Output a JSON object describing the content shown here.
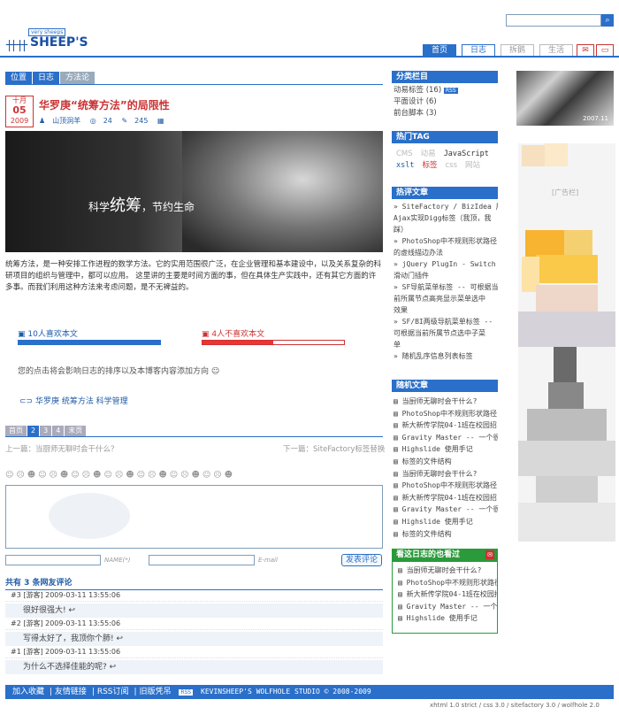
{
  "header": {
    "logo_tag": "very sheeps",
    "logo_text": "SHEEP'S",
    "search_icon": "search-icon",
    "nav": [
      {
        "label": "首页",
        "active": true
      },
      {
        "label": "日志",
        "active": false
      },
      {
        "label": "拆鹅",
        "active": false
      },
      {
        "label": "生活",
        "active": false
      }
    ]
  },
  "breadcrumb": [
    "位置",
    "日志",
    "方法论"
  ],
  "post": {
    "month": "十月",
    "day": "05",
    "year": "2009",
    "title": "华罗庚“统筹方法”的局限性",
    "author": "山顶洞羊",
    "views": "24",
    "comments": "245",
    "hero_prefix": "科学",
    "hero_big": "统筹",
    "hero_suffix": "，节约生命",
    "body": "统筹方法，是一种安排工作进程的数学方法。它的实用范围很广泛，在企业管理和基本建设中，以及关系复杂的科研项目的组织与管理中，都可以应用。 这里讲的主要是时间方面的事，但在具体生产实践中，还有其它方面的许多事。而我们利用这种方法来考虑问题，是不无裨益的。",
    "like_label": "10人喜欢本文",
    "like_fraction": 1.0,
    "dislike_label": "4人不喜欢本文",
    "dislike_fraction": 0.5,
    "vote_note": "您的点击将会影响日志的排序以及本博客内容添加方向",
    "tags": "华罗庚 统筹方法 科学管理"
  },
  "pager": [
    "首页",
    "2",
    "3",
    "4",
    "末页"
  ],
  "prev_link": "上一篇：当厨师无聊时会干什么？",
  "next_link": "下一篇：SiteFactory标签替换",
  "form": {
    "name_label": "NAME(*)",
    "email_label": "E-mail",
    "submit": "发表评论"
  },
  "comments_head": "共有 3 条网友评论",
  "comments": [
    {
      "meta": "#3 [游客] 2009-03-11 13:55:06",
      "text": "很好很强大!"
    },
    {
      "meta": "#2 [游客] 2009-03-11 13:55:06",
      "text": "写得太好了，我顶你个肺!"
    },
    {
      "meta": "#1 [游客] 2009-03-11 13:55:06",
      "text": "为什么不选择佳能的呢?"
    }
  ],
  "sidebar": {
    "categories_title": "分类栏目",
    "categories": [
      "动易标签 (16)",
      "平面设计 (6)",
      "前台脚本 (3)"
    ],
    "rss_badge": "RSS",
    "tags_title": "热门TAG",
    "tags": [
      "CMS",
      "动易",
      "JavaScript",
      "xslt",
      "标签",
      "css",
      "网站"
    ],
    "hot_title": "热评文章",
    "hot": [
      "» SiteFactory / BizIdea 用",
      "   Ajax实现Digg标签（我顶，我",
      "   踩）",
      "» PhotoShop中不规则形状路径",
      "   的虚线描边办法",
      "» jQuery PlugIn - Switch Tab",
      "   滑动门插件",
      "» SF导航菜单标签 -- 可根据当",
      "   前所属节点高亮显示菜单选中",
      "   效果",
      "» SF/BI两级导航菜单标签 --",
      "   可根据当前所属节点选中子菜",
      "   单",
      "» 随机乱序信息列表标签"
    ],
    "random_title": "随机文章",
    "random": [
      "当厨师无聊时会干什么?",
      "PhotoShop中不规则形状路径",
      "新大新传学院04-1班在校园招",
      "Gravity Master -- 一个很好",
      "Highslide 使用手记",
      "标签的文件结构",
      "当厨师无聊时会干什么?",
      "PhotoShop中不规则形状路径",
      "新大新传学院04-1班在校园招",
      "Gravity Master -- 一个很好",
      "Highslide 使用手记",
      "标签的文件结构"
    ],
    "also_title": "看这日志的也看过",
    "also": [
      "当厨师无聊时会干什么?",
      "PhotoShop中不规则形状路径",
      "新大新传学院04-1班在校园招",
      "Gravity Master -- 一个很好",
      "Highslide 使用手记"
    ],
    "ad_caption": "2007.11",
    "ad_label": "[广告栏]"
  },
  "footer": {
    "links": [
      "加入收藏",
      "友情链接",
      "RSS订阅",
      "旧版凭吊"
    ],
    "copyright": "KEVINSHEEP'S WOLFHOLE STUDIO © 2008-2009",
    "right": "xhtml 1.0 strict / css 3.0 / sitefactory 3.0 / wolfhole 2.0"
  },
  "colors": {
    "accent": "#2a6fc9",
    "red": "#cc3333",
    "green": "#2a9a3a"
  }
}
